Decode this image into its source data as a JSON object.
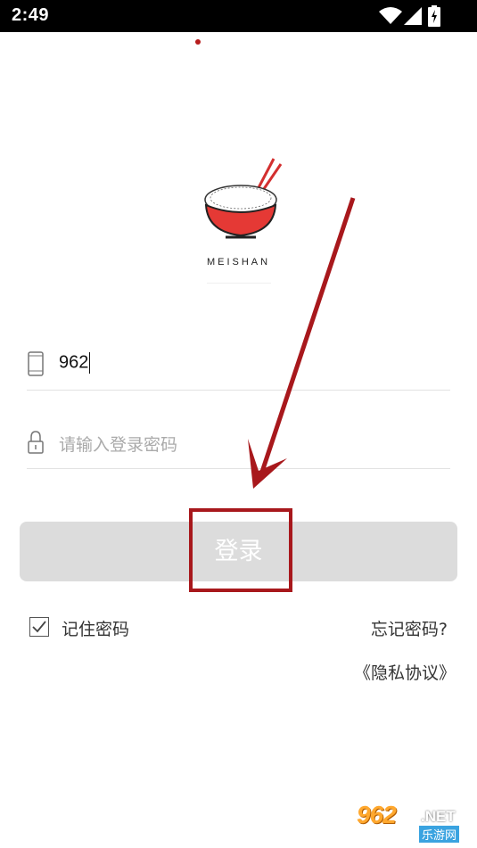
{
  "status_bar": {
    "time": "2:49"
  },
  "brand": {
    "name": "MEISHAN"
  },
  "login_form": {
    "phone_value": "962",
    "password_placeholder": "请输入登录密码",
    "login_label": "登录",
    "remember_label": "记住密码",
    "remember_checked": true,
    "forgot_label": "忘记密码?",
    "privacy_label": "《隐私协议》"
  },
  "colors": {
    "brand_red": "#d32f2f",
    "annotation_red": "#a8181c",
    "button_disabled": "#dcdcdc"
  },
  "watermark": {
    "main": "962",
    "suffix": ".NET",
    "sub": "乐游网"
  }
}
